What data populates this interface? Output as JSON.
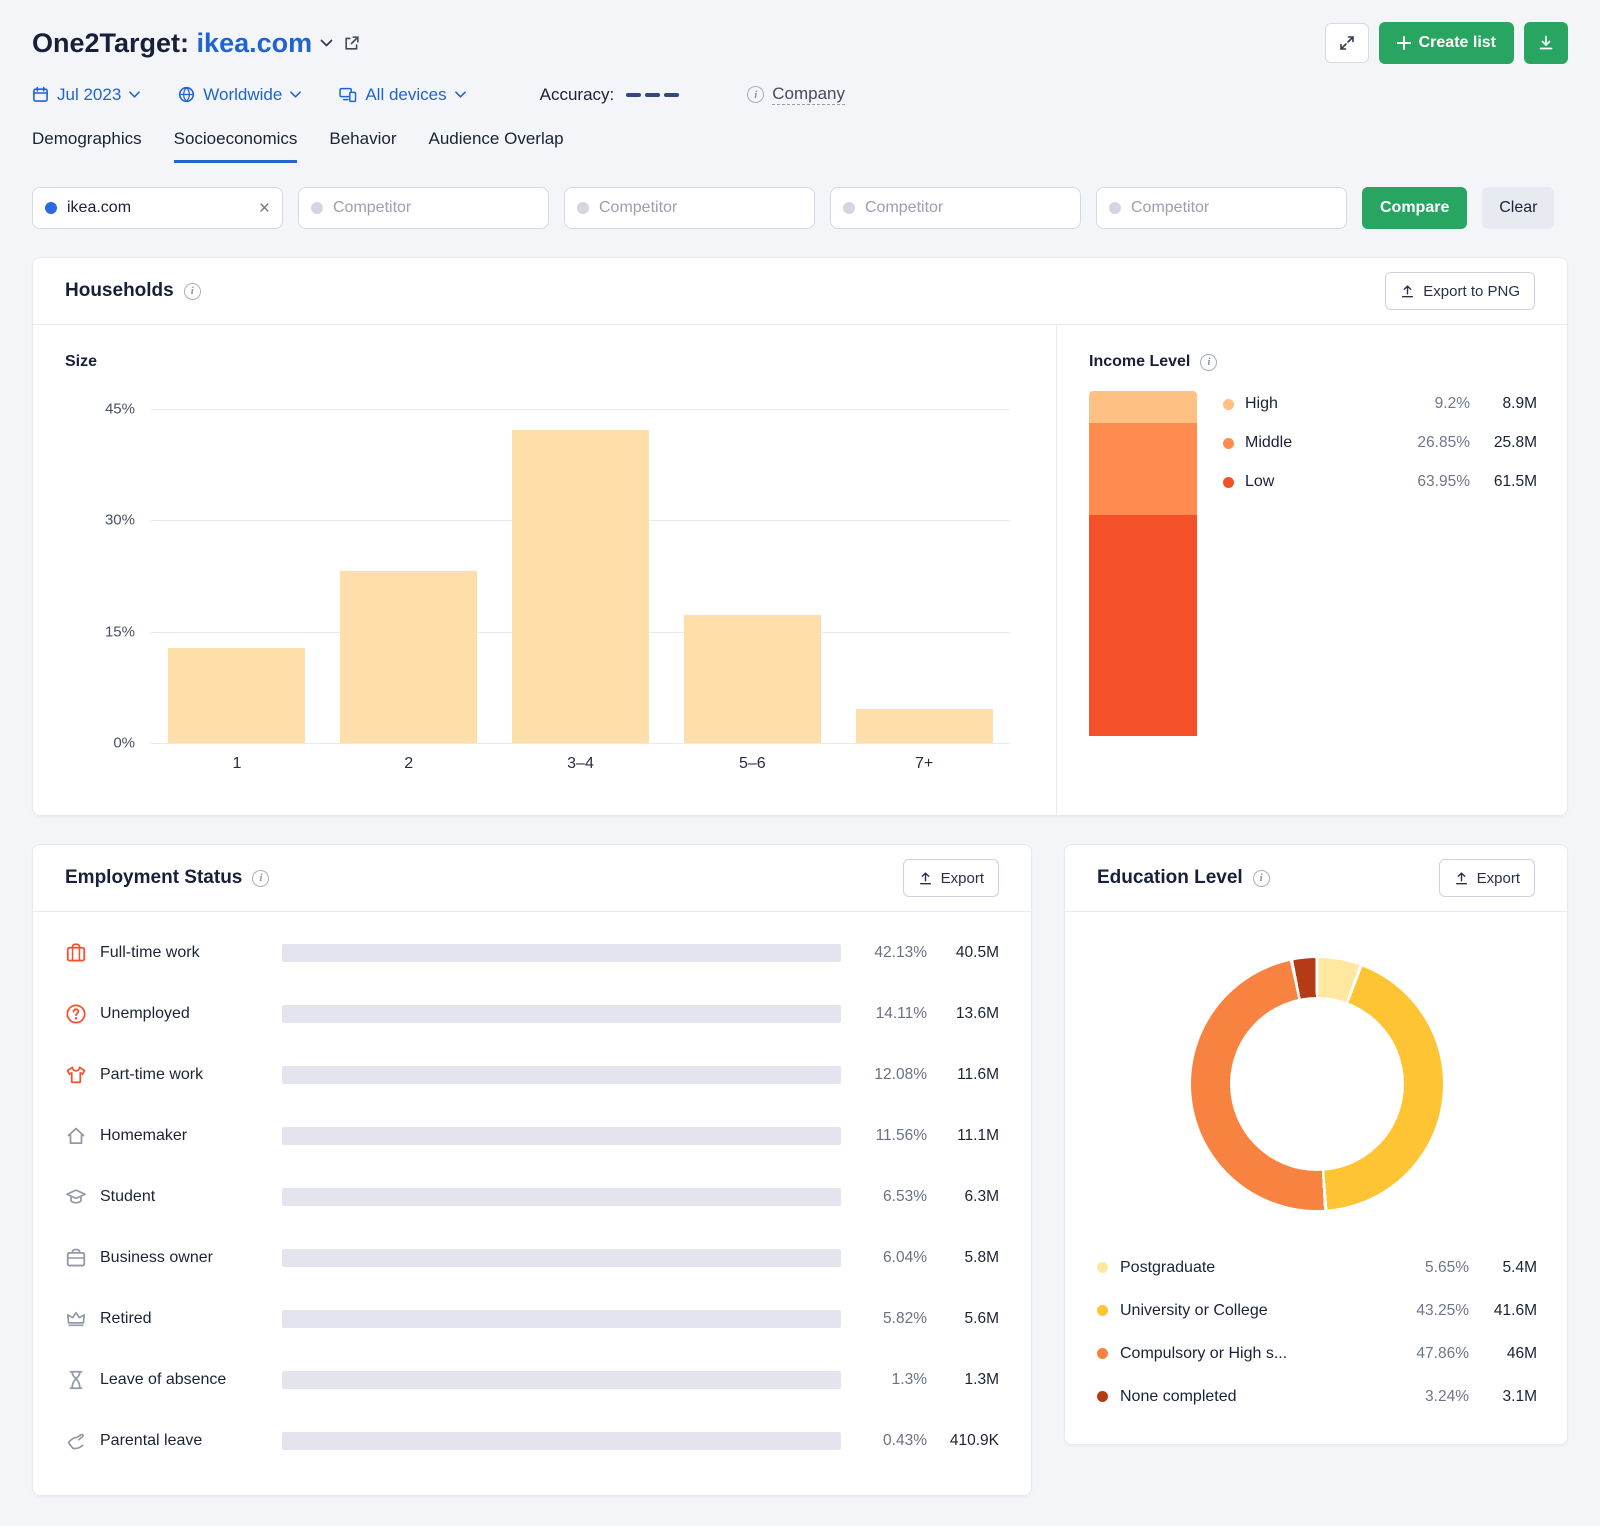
{
  "misc": {
    "info_glyph": "i"
  },
  "colors": {
    "accent_blue": "#1F64D1",
    "accent_green": "#28A561",
    "size_bar": "#FFDFA9",
    "employment_fill": "#FFC53D",
    "employment_track": "#E3E4ED"
  },
  "header": {
    "title": "One2Target:",
    "domain": "ikea.com",
    "create_list_label": "Create list",
    "filters": {
      "date": "Jul 2023",
      "region": "Worldwide",
      "devices": "All devices",
      "accuracy_label": "Accuracy:",
      "company_label": "Company"
    },
    "tabs": [
      {
        "label": "Demographics"
      },
      {
        "label": "Socioeconomics"
      },
      {
        "label": "Behavior"
      },
      {
        "label": "Audience Overlap"
      }
    ]
  },
  "competitor_bar": {
    "selected_domain": "ikea.com",
    "competitor_placeholder": "Competitor",
    "compare_label": "Compare",
    "clear_label": "Clear"
  },
  "cards": {
    "households": {
      "title": "Households",
      "export_label": "Export to PNG"
    },
    "employment": {
      "title": "Employment Status",
      "export_label": "Export"
    },
    "education": {
      "title": "Education Level",
      "export_label": "Export"
    }
  },
  "chart_data": [
    {
      "id": "household-size",
      "type": "bar",
      "title": "Size",
      "categories": [
        "1",
        "2",
        "3–4",
        "5–6",
        "7+"
      ],
      "values": [
        12.8,
        23.2,
        42.2,
        17.2,
        4.6
      ],
      "ymax": 45,
      "y_ticks": [
        "45%",
        "30%",
        "15%",
        "0%"
      ],
      "bar_color": "#FFDFA9"
    },
    {
      "id": "income-level",
      "type": "stacked-bar",
      "title": "Income Level",
      "items": [
        {
          "label": "High",
          "percent": "9.2%",
          "percent_num": 9.2,
          "value": "8.9M",
          "color": "#FFC183"
        },
        {
          "label": "Middle",
          "percent": "26.85%",
          "percent_num": 26.85,
          "value": "25.8M",
          "color": "#FF8C4E"
        },
        {
          "label": "Low",
          "percent": "63.95%",
          "percent_num": 63.95,
          "value": "61.5M",
          "color": "#F4502A"
        }
      ]
    },
    {
      "id": "employment-status",
      "type": "hbar",
      "rows": [
        {
          "label": "Full-time work",
          "icon": "suitcase-icon",
          "percent": "42.13%",
          "percent_num": 42.13,
          "value": "40.5M"
        },
        {
          "label": "Unemployed",
          "icon": "question-circle-icon",
          "percent": "14.11%",
          "percent_num": 14.11,
          "value": "13.6M"
        },
        {
          "label": "Part-time work",
          "icon": "tshirt-icon",
          "percent": "12.08%",
          "percent_num": 12.08,
          "value": "11.6M"
        },
        {
          "label": "Homemaker",
          "icon": "house-icon",
          "percent": "11.56%",
          "percent_num": 11.56,
          "value": "11.1M"
        },
        {
          "label": "Student",
          "icon": "graduation-cap-icon",
          "percent": "6.53%",
          "percent_num": 6.53,
          "value": "6.3M"
        },
        {
          "label": "Business owner",
          "icon": "briefcase-icon",
          "percent": "6.04%",
          "percent_num": 6.04,
          "value": "5.8M"
        },
        {
          "label": "Retired",
          "icon": "crown-icon",
          "percent": "5.82%",
          "percent_num": 5.82,
          "value": "5.6M"
        },
        {
          "label": "Leave of absence",
          "icon": "hourglass-icon",
          "percent": "1.3%",
          "percent_num": 1.3,
          "value": "1.3M"
        },
        {
          "label": "Parental leave",
          "icon": "hand-icon",
          "percent": "0.43%",
          "percent_num": 0.43,
          "value": "410.9K"
        }
      ]
    },
    {
      "id": "education-level",
      "type": "donut",
      "items": [
        {
          "label": "Postgraduate",
          "percent": "5.65%",
          "percent_num": 5.65,
          "value": "5.4M",
          "color": "#FFE7A0"
        },
        {
          "label": "University or College",
          "percent": "43.25%",
          "percent_num": 43.25,
          "value": "41.6M",
          "color": "#FFC434"
        },
        {
          "label": "Compulsory or High s...",
          "percent": "47.86%",
          "percent_num": 47.86,
          "value": "46M",
          "color": "#F8823F"
        },
        {
          "label": "None completed",
          "percent": "3.24%",
          "percent_num": 3.24,
          "value": "3.1M",
          "color": "#B43B16"
        }
      ]
    }
  ]
}
